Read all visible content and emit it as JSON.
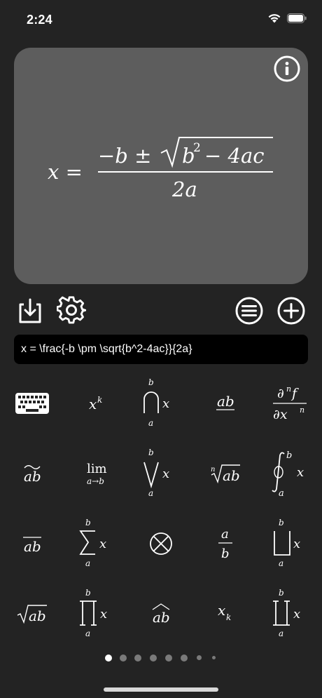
{
  "status_bar": {
    "time": "2:24"
  },
  "preview": {
    "formula_left": "x =",
    "numerator_minus_b": "−b ±",
    "radicand": "b",
    "radicand_exp": "2",
    "radicand_rest": "− 4ac",
    "denominator": "2a"
  },
  "toolbar": {
    "icons": [
      "download-icon",
      "gear-icon",
      "list-icon",
      "plus-icon"
    ]
  },
  "latex_input": {
    "value": "x = \\frac{-b \\pm \\sqrt{b^2-4ac}}{2a}"
  },
  "keypad": {
    "rows": [
      [
        "keyboard",
        "x^k",
        "bigcap",
        "underline ab",
        "partial derivative"
      ],
      [
        "widetilde ab",
        "lim",
        "bigvee",
        "nth root",
        "oint"
      ],
      [
        "overline ab",
        "sum",
        "otimes",
        "fraction a/b",
        "coprod-like bigsqcup"
      ],
      [
        "sqrt ab",
        "prod",
        "widehat ab",
        "x_k",
        "coprod"
      ]
    ],
    "labels": {
      "x": "x",
      "k": "k",
      "a": "a",
      "b": "b",
      "ab": "ab",
      "n": "n",
      "f": "f",
      "lim": "lim",
      "arrow_sub": "a→b",
      "partial": "∂",
      "xn": "∂x"
    }
  },
  "page_control": {
    "pages": 8,
    "current": 1
  }
}
